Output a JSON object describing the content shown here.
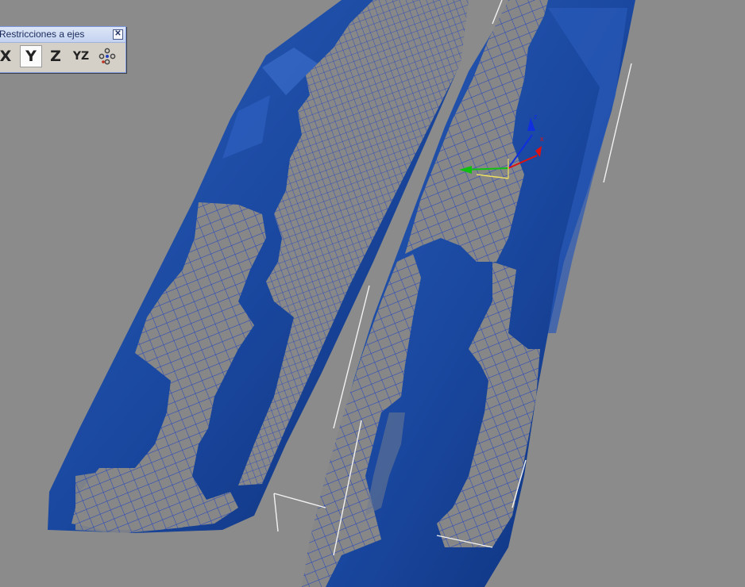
{
  "window": {
    "title": "Restricciones a ejes",
    "close_glyph": "✕"
  },
  "toolbar": {
    "buttons": [
      {
        "label": "X",
        "name": "constrain-x-button",
        "active": false
      },
      {
        "label": "Y",
        "name": "constrain-y-button",
        "active": true
      },
      {
        "label": "Z",
        "name": "constrain-z-button",
        "active": false
      },
      {
        "label": "YZ",
        "name": "constrain-yz-button",
        "active": false
      },
      {
        "icon": "snap-options-icon",
        "name": "snap-options-button",
        "active": false
      }
    ]
  },
  "gizmo": {
    "axes": [
      "x",
      "y",
      "z"
    ],
    "colors": {
      "x": "#e01010",
      "y": "#10c010",
      "z": "#1030e0"
    }
  },
  "colors": {
    "background": "#8b8b8b",
    "mesh_fill": "#1f4fa8",
    "mesh_dark": "#0c2a70",
    "wire": "#1b3fc4",
    "gray_face": "#858585"
  }
}
